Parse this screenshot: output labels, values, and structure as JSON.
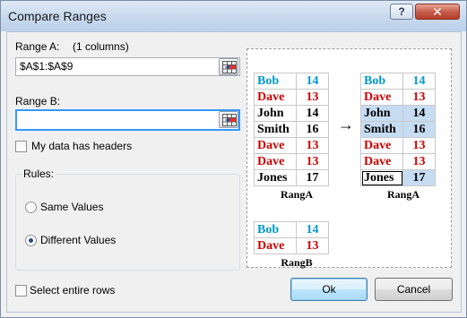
{
  "window": {
    "title": "Compare Ranges",
    "help_label": "?",
    "close_label": "✕"
  },
  "range_a": {
    "label": "Range A:",
    "note": "(1 columns)",
    "value": "$A$1:$A$9",
    "picker_icon": "range-select-icon"
  },
  "range_b": {
    "label": "Range B:",
    "value": "",
    "picker_icon": "range-select-icon"
  },
  "headers_checkbox": {
    "label": "My data has headers",
    "checked": false
  },
  "rules": {
    "title": "Rules:",
    "options": [
      {
        "label": "Same Values",
        "selected": false
      },
      {
        "label": "Different Values",
        "selected": true
      }
    ]
  },
  "select_rows_checkbox": {
    "label": "Select entire rows",
    "checked": false
  },
  "buttons": {
    "ok": "Ok",
    "cancel": "Cancel"
  },
  "preview": {
    "left_table": {
      "caption": "RangA",
      "rows": [
        {
          "name": "Bob",
          "num": "14",
          "style": "blue"
        },
        {
          "name": "Dave",
          "num": "13",
          "style": "red"
        },
        {
          "name": "John",
          "num": "14",
          "style": "plain"
        },
        {
          "name": "Smith",
          "num": "16",
          "style": "plain"
        },
        {
          "name": "Dave",
          "num": "13",
          "style": "red"
        },
        {
          "name": "Dave",
          "num": "13",
          "style": "red"
        },
        {
          "name": "Jones",
          "num": "17",
          "style": "plain"
        }
      ]
    },
    "arrow": "→",
    "right_table": {
      "caption": "RangA",
      "rows": [
        {
          "name": "Bob",
          "num": "14",
          "style": "blue"
        },
        {
          "name": "Dave",
          "num": "13",
          "style": "red"
        },
        {
          "name": "John",
          "num": "14",
          "style": "plain-hl"
        },
        {
          "name": "Smith",
          "num": "16",
          "style": "plain-hl"
        },
        {
          "name": "Dave",
          "num": "13",
          "style": "red"
        },
        {
          "name": "Dave",
          "num": "13",
          "style": "red"
        },
        {
          "name": "Jones",
          "num": "17",
          "style": "plain-hl-outlined"
        }
      ]
    },
    "bottom_table": {
      "caption": "RangB",
      "rows": [
        {
          "name": "Bob",
          "num": "14",
          "style": "blue"
        },
        {
          "name": "Dave",
          "num": "13",
          "style": "red"
        }
      ]
    }
  }
}
